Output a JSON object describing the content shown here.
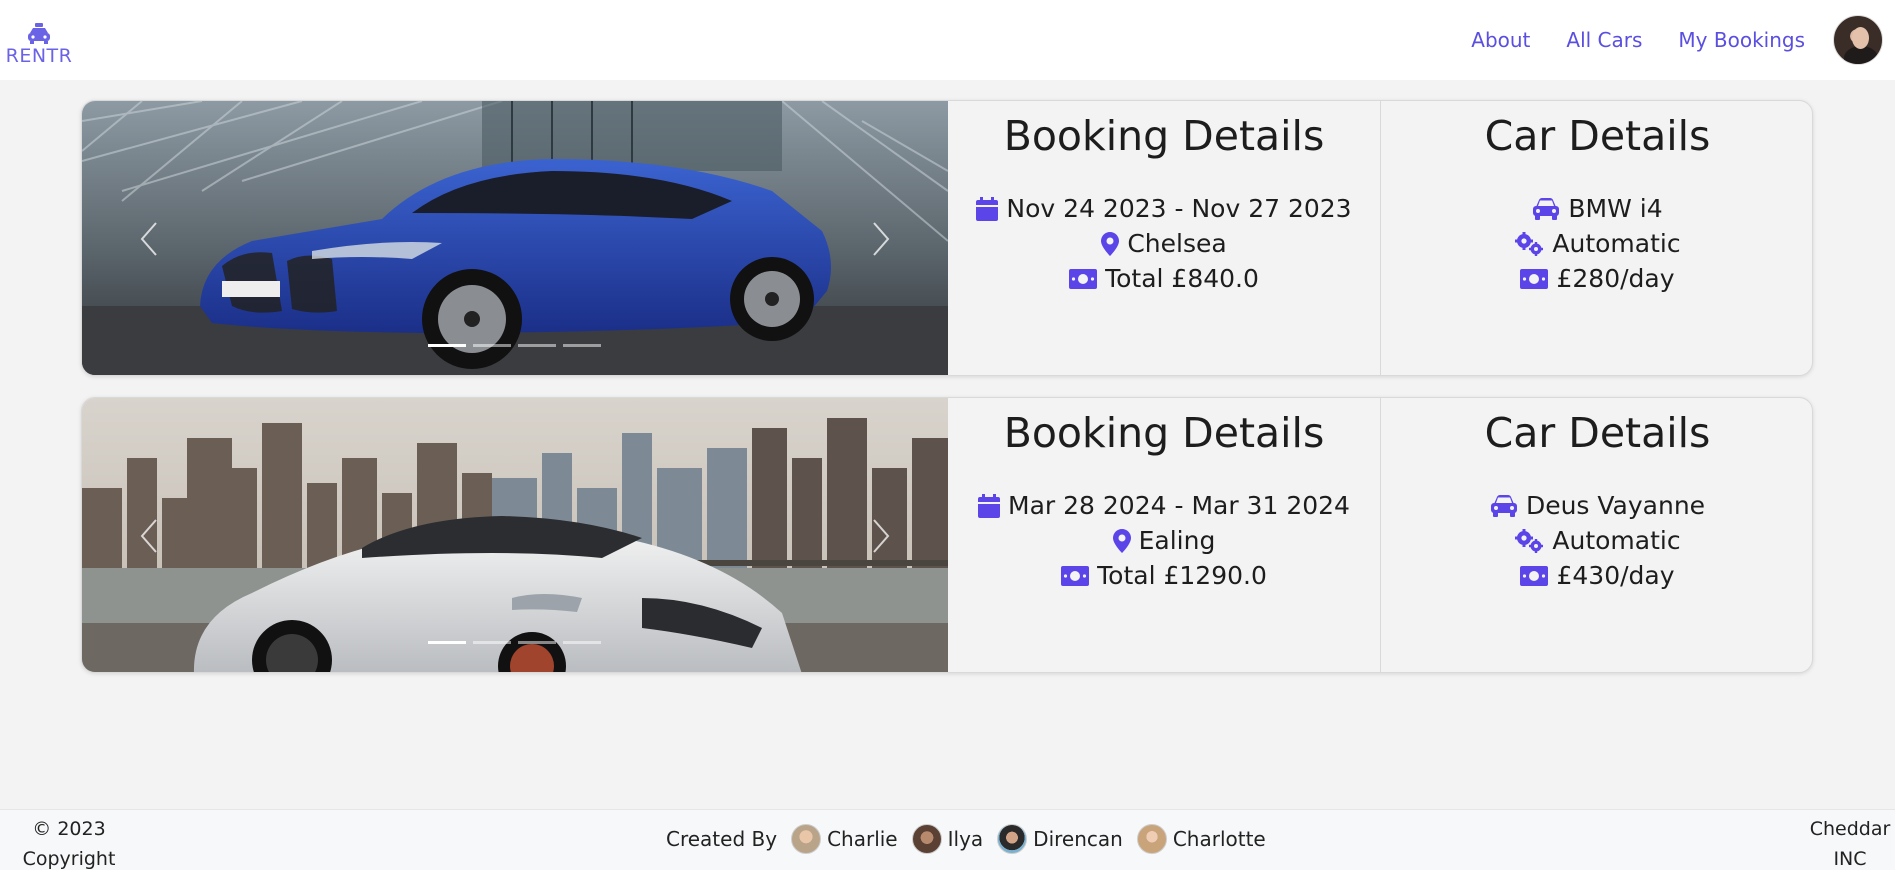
{
  "app": {
    "logo_text": "RENTR"
  },
  "nav": {
    "links": [
      "About",
      "All Cars",
      "My Bookings"
    ]
  },
  "bookings": [
    {
      "booking_title": "Booking Details",
      "dates": "Nov 24 2023 - Nov 27 2023",
      "location": "Chelsea",
      "total": "Total £840.0",
      "car_title": "Car Details",
      "car_name": "BMW i4",
      "transmission": "Automatic",
      "price": "£280/day",
      "indicators": 4,
      "active_indicator": 0
    },
    {
      "booking_title": "Booking Details",
      "dates": "Mar 28 2024 - Mar 31 2024",
      "location": "Ealing",
      "total": "Total £1290.0",
      "car_title": "Car Details",
      "car_name": "Deus Vayanne",
      "transmission": "Automatic",
      "price": "£430/day",
      "indicators": 4,
      "active_indicator": 0
    }
  ],
  "footer": {
    "copyright": "© 2023 Copyright",
    "created_by": "Created By",
    "members": [
      "Charlie",
      "Ilya",
      "Direncan",
      "Charlotte"
    ],
    "company": "Cheddar INC"
  },
  "colors": {
    "accent": "#5a4fe0",
    "icon": "#5b45e8",
    "background": "#f3f3f3"
  },
  "icons": {
    "dates": "calendar-icon",
    "location": "map-pin-icon",
    "total": "money-icon",
    "car": "car-icon",
    "transmission": "gears-icon",
    "price": "money-icon"
  }
}
